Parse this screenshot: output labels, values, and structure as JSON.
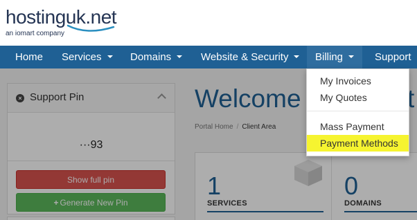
{
  "logo": {
    "brand_prefix": "hostinguk",
    "brand_suffix": ".net",
    "tagline": "an iomart company",
    "accent": "#253554"
  },
  "nav": {
    "background": "#1f6094",
    "items": [
      {
        "label": "Home",
        "has_caret": false
      },
      {
        "label": "Services",
        "has_caret": true
      },
      {
        "label": "Domains",
        "has_caret": true
      },
      {
        "label": "Website & Security",
        "has_caret": true
      },
      {
        "label": "Billing",
        "has_caret": true
      },
      {
        "label": "Support",
        "has_caret": false
      }
    ]
  },
  "billing_menu": {
    "items": [
      {
        "label": "My Invoices"
      },
      {
        "label": "My Quotes"
      },
      {
        "label": "Mass Payment"
      },
      {
        "label": "Payment Methods",
        "highlighted": true
      }
    ],
    "highlight_color": "#f6f430"
  },
  "support_pin": {
    "title": "Support Pin",
    "pin": "···93",
    "show_button": "Show full pin",
    "generate_button": "Generate New Pin"
  },
  "main": {
    "welcome": "Welcome",
    "welcome_tail": "t",
    "breadcrumb": {
      "home": "Portal Home",
      "current": "Client Area"
    },
    "stats": [
      {
        "value": "1",
        "label": "SERVICES"
      },
      {
        "value": "0",
        "label": "DOMAINS"
      }
    ]
  }
}
